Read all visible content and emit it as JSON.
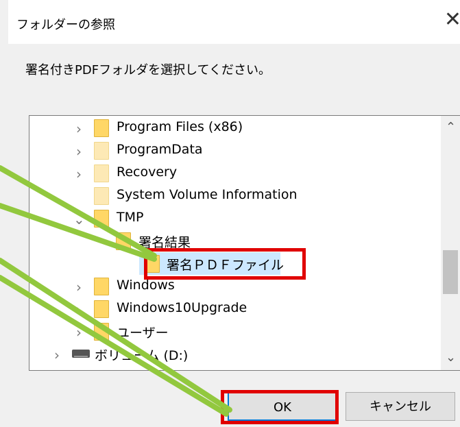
{
  "dialog": {
    "title": "フォルダーの参照",
    "close_glyph": "✕",
    "instruction": "署名付きPDFフォルダを選択してください。"
  },
  "tree": {
    "items": [
      {
        "label": "Program Files (x86)",
        "expander": "›",
        "icon": "folder-icon",
        "selected": false
      },
      {
        "label": "ProgramData",
        "expander": "›",
        "icon": "folder-icon",
        "selected": false
      },
      {
        "label": "Recovery",
        "expander": "›",
        "icon": "folder-icon",
        "selected": false
      },
      {
        "label": "System Volume Information",
        "expander": "",
        "icon": "folder-icon",
        "selected": false
      },
      {
        "label": "TMP",
        "expander": "⌄",
        "icon": "folder-icon",
        "selected": false
      },
      {
        "label": "署名結果",
        "expander": "",
        "icon": "folder-icon",
        "selected": false
      },
      {
        "label": "署名ＰＤＦファイル",
        "expander": "",
        "icon": "folder-icon",
        "selected": true
      },
      {
        "label": "Windows",
        "expander": "›",
        "icon": "folder-icon",
        "selected": false
      },
      {
        "label": "Windows10Upgrade",
        "expander": "›",
        "icon": "folder-icon",
        "selected": false
      },
      {
        "label": "ユーザー",
        "expander": "›",
        "icon": "folder-icon",
        "selected": false
      },
      {
        "label": "ボリューム (D:)",
        "expander": "›",
        "icon": "drive-icon",
        "selected": false
      }
    ],
    "scroll_up": "⌃",
    "scroll_down": "⌄"
  },
  "buttons": {
    "ok": "OK",
    "cancel": "キャンセル"
  },
  "colors": {
    "highlight": "#e00000",
    "callout": "#92c83e",
    "selection": "#cce8ff",
    "focus": "#0078d7"
  }
}
